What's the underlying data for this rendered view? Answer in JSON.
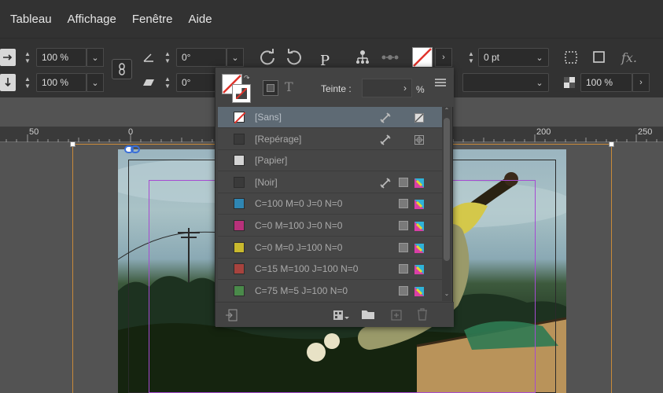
{
  "menubar": {
    "items": [
      "Tableau",
      "Affichage",
      "Fenêtre",
      "Aide"
    ]
  },
  "controlbar": {
    "scale_x": "100 %",
    "scale_y": "100 %",
    "rotation": "0°",
    "shear": "0°",
    "stroke_weight": "0 pt",
    "opacity": "100 %",
    "text_frame_glyph": "P"
  },
  "ruler": {
    "labels": [
      "50",
      "0",
      "200",
      "250"
    ]
  },
  "swatches_panel": {
    "tint_label": "Teinte :",
    "tint_value": "",
    "percent": "%",
    "items": [
      {
        "name": "[Sans]",
        "color": "none",
        "selected": true
      },
      {
        "name": "[Repérage]",
        "color": "#3a3a3a",
        "selected": false
      },
      {
        "name": "[Papier]",
        "color": "#d4d4d4",
        "selected": false
      },
      {
        "name": "[Noir]",
        "color": "#3a3a3a",
        "selected": false
      },
      {
        "name": "C=100 M=0 J=0 N=0",
        "color": "#2f86b3",
        "selected": false
      },
      {
        "name": "C=0 M=100 J=0 N=0",
        "color": "#b8317a",
        "selected": false
      },
      {
        "name": "C=0 M=0 J=100 N=0",
        "color": "#c9b92e",
        "selected": false
      },
      {
        "name": "C=15 M=100 J=100 N=0",
        "color": "#a7433e",
        "selected": false
      },
      {
        "name": "C=75 M=5 J=100 N=0",
        "color": "#4a8a4a",
        "selected": false
      }
    ]
  },
  "colors": {
    "menubar_bg": "#323232",
    "panel_bg": "#434343",
    "selected_row": "#5e6a74",
    "accent_red": "#e0332b"
  }
}
